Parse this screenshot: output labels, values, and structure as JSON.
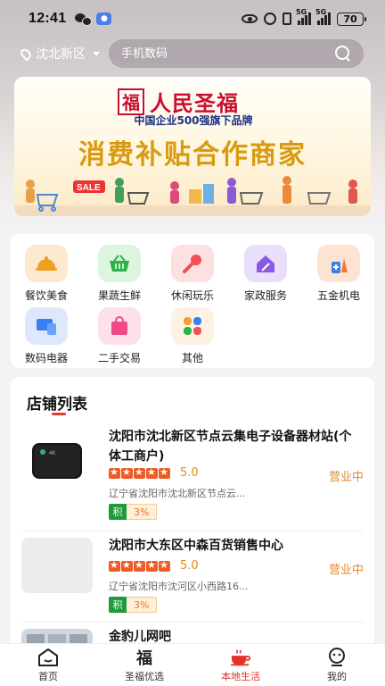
{
  "status_bar": {
    "time": "12:41",
    "network_label_1": "5G",
    "network_label_2": "5G",
    "battery": "70"
  },
  "header": {
    "location": "沈北新区",
    "search_placeholder": "手机数码"
  },
  "banner": {
    "brand_seal": "福",
    "brand_name": "人民圣福",
    "brand_sub": "中国企业500强旗下品牌",
    "title": "消费补贴合作商家"
  },
  "categories": [
    {
      "label": "餐饮美食",
      "icon": "dish-cloche-icon",
      "bg": "#fde9cf",
      "color": "#f0a020"
    },
    {
      "label": "果蔬生鲜",
      "icon": "basket-icon",
      "bg": "#dcf5df",
      "color": "#2db24a"
    },
    {
      "label": "休闲玩乐",
      "icon": "microphone-icon",
      "bg": "#fde0e0",
      "color": "#f05050"
    },
    {
      "label": "家政服务",
      "icon": "house-broom-icon",
      "bg": "#eadffa",
      "color": "#8a5ae0"
    },
    {
      "label": "五金机电",
      "icon": "spray-bottle-icon",
      "bg": "#fde4d2",
      "color": "#f07a30"
    },
    {
      "label": "数码电器",
      "icon": "devices-icon",
      "bg": "#dde9fb",
      "color": "#3a7ff0"
    },
    {
      "label": "二手交易",
      "icon": "shopping-bag-icon",
      "bg": "#fde0ea",
      "color": "#f04a86"
    },
    {
      "label": "其他",
      "icon": "grid-apps-icon",
      "bg": "#fdf1e3",
      "color": "#f2a030"
    }
  ],
  "store_list": {
    "heading": "店铺列表",
    "stores": [
      {
        "name": "沈阳市沈北新区节点云集电子设备器材站(个体工商户)",
        "rating": "5.0",
        "status": "营业中",
        "address": "辽宁省沈阳市沈北新区节点云...",
        "points_label": "积",
        "points_rate": "3%"
      },
      {
        "name": "沈阳市大东区中森百货销售中心",
        "rating": "5.0",
        "status": "营业中",
        "address": "辽宁省沈阳市沈河区小西路16...",
        "points_label": "积",
        "points_rate": "3%"
      },
      {
        "name": "金豹儿网吧"
      }
    ]
  },
  "bottom_nav": [
    {
      "label": "首页",
      "icon": "home-icon",
      "active": false
    },
    {
      "label": "圣福优选",
      "icon": "fu-icon",
      "active": false
    },
    {
      "label": "本地生活",
      "icon": "coffee-cup-icon",
      "active": true
    },
    {
      "label": "我的",
      "icon": "profile-icon",
      "active": false
    }
  ],
  "colors": {
    "accent": "#e0342b",
    "open_status": "#e68a2b",
    "points_green": "#1e9b3c"
  }
}
